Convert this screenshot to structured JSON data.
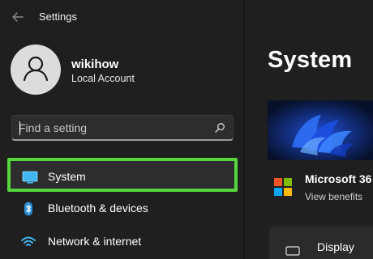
{
  "window": {
    "title": "Settings",
    "back_icon": "arrow-left-icon"
  },
  "account": {
    "name": "wikihow",
    "type": "Local Account",
    "avatar_icon": "person-icon"
  },
  "search": {
    "placeholder": "Find a setting",
    "icon": "search-icon"
  },
  "nav": {
    "items": [
      {
        "label": "System",
        "icon": "monitor-icon",
        "selected": true
      },
      {
        "label": "Bluetooth & devices",
        "icon": "bluetooth-icon",
        "selected": false
      },
      {
        "label": "Network & internet",
        "icon": "wifi-icon",
        "selected": false
      }
    ],
    "highlight_color": "#55d63c"
  },
  "main": {
    "title": "System",
    "subscription": {
      "title": "Microsoft 36",
      "link": "View benefits",
      "icon": "microsoft-logo"
    },
    "display": {
      "label": "Display",
      "icon": "monitor-outline-icon"
    }
  },
  "colors": {
    "background": "#1f1f1f",
    "accent": "#60cdff",
    "surface": "#2d2d2d"
  }
}
